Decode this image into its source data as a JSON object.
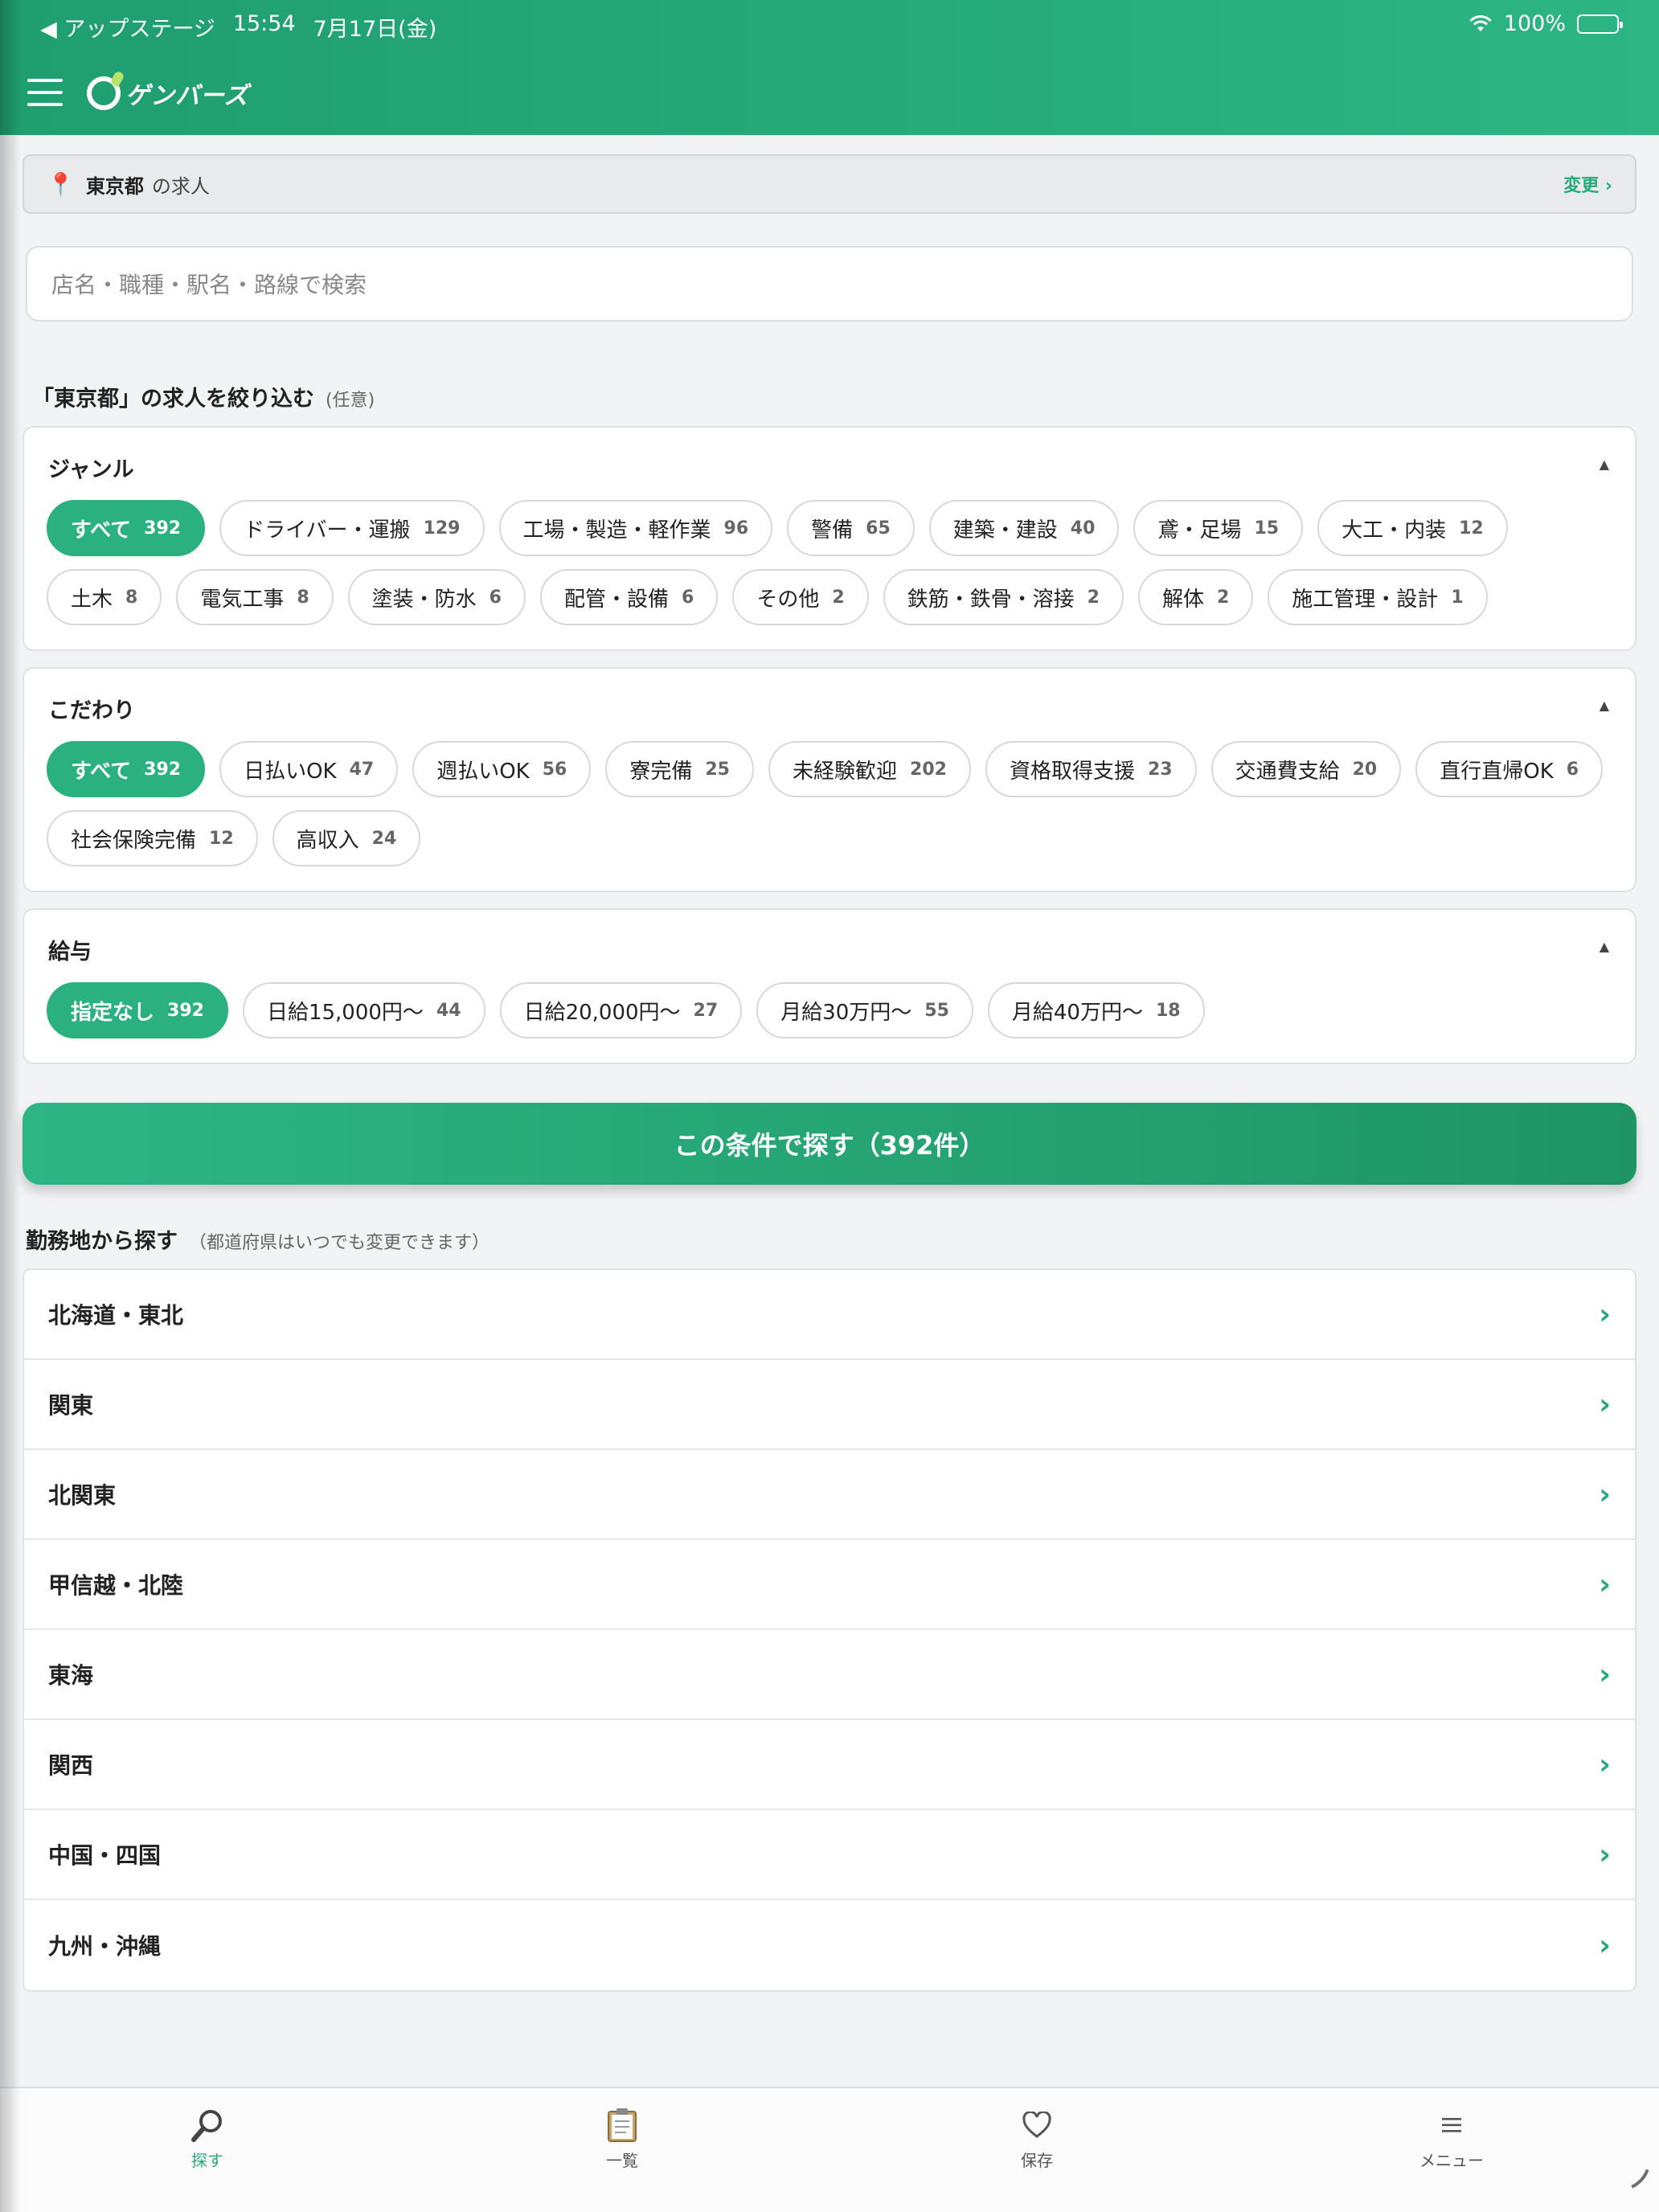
{
  "status": {
    "back_app": "◀ アップステージ",
    "time": "15:54",
    "date": "7月17日(金)",
    "battery": "100%"
  },
  "header": {
    "logo_text": "ゲンバーズ"
  },
  "location": {
    "prefecture": "東京都",
    "suffix": "の求人",
    "change_label": "変更 ›"
  },
  "search": {
    "placeholder": "店名・職種・駅名・路線で検索"
  },
  "filter_section": {
    "title": "「東京都」の求人を絞り込む",
    "note": "(任意)"
  },
  "genre": {
    "title": "ジャンル",
    "chips": [
      {
        "label": "すべて",
        "count": "392"
      },
      {
        "label": "ドライバー・運搬",
        "count": "129"
      },
      {
        "label": "工場・製造・軽作業",
        "count": "96"
      },
      {
        "label": "警備",
        "count": "65"
      },
      {
        "label": "建築・建設",
        "count": "40"
      },
      {
        "label": "鳶・足場",
        "count": "15"
      },
      {
        "label": "大工・内装",
        "count": "12"
      },
      {
        "label": "土木",
        "count": "8"
      },
      {
        "label": "電気工事",
        "count": "8"
      },
      {
        "label": "塗装・防水",
        "count": "6"
      },
      {
        "label": "配管・設備",
        "count": "6"
      },
      {
        "label": "その他",
        "count": "2"
      },
      {
        "label": "鉄筋・鉄骨・溶接",
        "count": "2"
      },
      {
        "label": "解体",
        "count": "2"
      },
      {
        "label": "施工管理・設計",
        "count": "1"
      }
    ]
  },
  "kodawari": {
    "title": "こだわり",
    "chips": [
      {
        "label": "すべて",
        "count": "392"
      },
      {
        "label": "日払いOK",
        "count": "47"
      },
      {
        "label": "週払いOK",
        "count": "56"
      },
      {
        "label": "寮完備",
        "count": "25"
      },
      {
        "label": "未経験歓迎",
        "count": "202"
      },
      {
        "label": "資格取得支援",
        "count": "23"
      },
      {
        "label": "交通費支給",
        "count": "20"
      },
      {
        "label": "直行直帰OK",
        "count": "6"
      },
      {
        "label": "社会保険完備",
        "count": "12"
      },
      {
        "label": "高収入",
        "count": "24"
      }
    ]
  },
  "salary": {
    "title": "給与",
    "chips": [
      {
        "label": "指定なし",
        "count": "392"
      },
      {
        "label": "日給15,000円〜",
        "count": "44"
      },
      {
        "label": "日給20,000円〜",
        "count": "27"
      },
      {
        "label": "月給30万円〜",
        "count": "55"
      },
      {
        "label": "月給40万円〜",
        "count": "18"
      }
    ]
  },
  "cta": {
    "label": "この条件で探す（392件）"
  },
  "region_section": {
    "title": "勤務地から探す",
    "note": "（都道府県はいつでも変更できます）"
  },
  "regions": [
    "北海道・東北",
    "関東",
    "北関東",
    "甲信越・北陸",
    "東海",
    "関西",
    "中国・四国",
    "九州・沖縄"
  ],
  "tabs": {
    "search": "探す",
    "list": "一覧",
    "saved": "保存",
    "menu": "メニュー"
  },
  "colors": {
    "brand": "#2bb07f",
    "accent_text": "#27aa7a"
  }
}
